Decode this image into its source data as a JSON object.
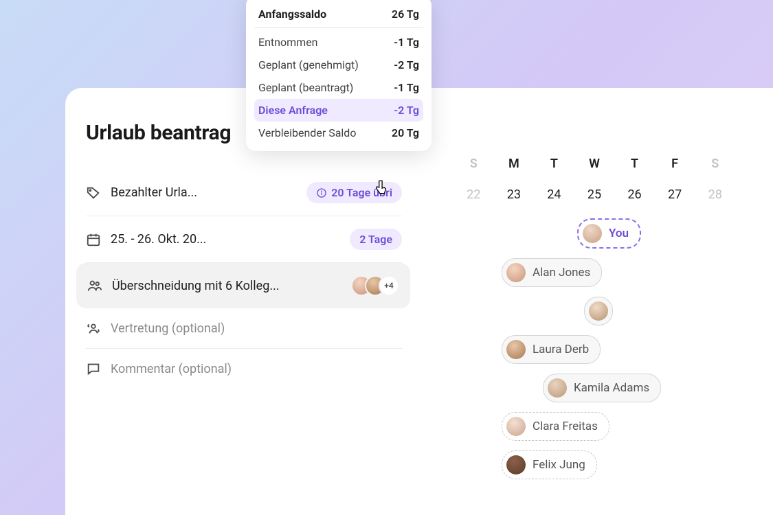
{
  "page": {
    "title": "Urlaub beantrag"
  },
  "form": {
    "type_label": "Bezahlter Urla...",
    "remaining_badge": "20 Tage übri",
    "date_label": "25. - 26. Okt. 20...",
    "duration_badge": "2 Tage",
    "overlap_label": "Überschneidung mit 6 Kolleg...",
    "overlap_more": "+4",
    "substitute_label": "Vertretung (optional)",
    "comment_label": "Kommentar (optional)"
  },
  "balance_tooltip": {
    "rows": [
      {
        "label": "Anfangssaldo",
        "value": "26 Tg",
        "head": true
      },
      {
        "label": "Entnommen",
        "value": "-1 Tg"
      },
      {
        "label": "Geplant (genehmigt)",
        "value": "-2 Tg"
      },
      {
        "label": "Geplant (beantragt)",
        "value": "-1 Tg"
      },
      {
        "label": "Diese Anfrage",
        "value": "-2 Tg",
        "highlight": true
      },
      {
        "label": "Verbleibender Saldo",
        "value": "20 Tg"
      }
    ]
  },
  "calendar": {
    "weekdays": [
      "S",
      "M",
      "T",
      "W",
      "T",
      "F",
      "S"
    ],
    "dates": [
      "22",
      "23",
      "24",
      "25",
      "26",
      "27",
      "28"
    ]
  },
  "people": {
    "you": "You",
    "p1": "Alan Jones",
    "p2": "",
    "p3": "Laura Derb",
    "p4": "Kamila Adams",
    "p5": "Clara Freitas",
    "p6": "Felix Jung"
  }
}
